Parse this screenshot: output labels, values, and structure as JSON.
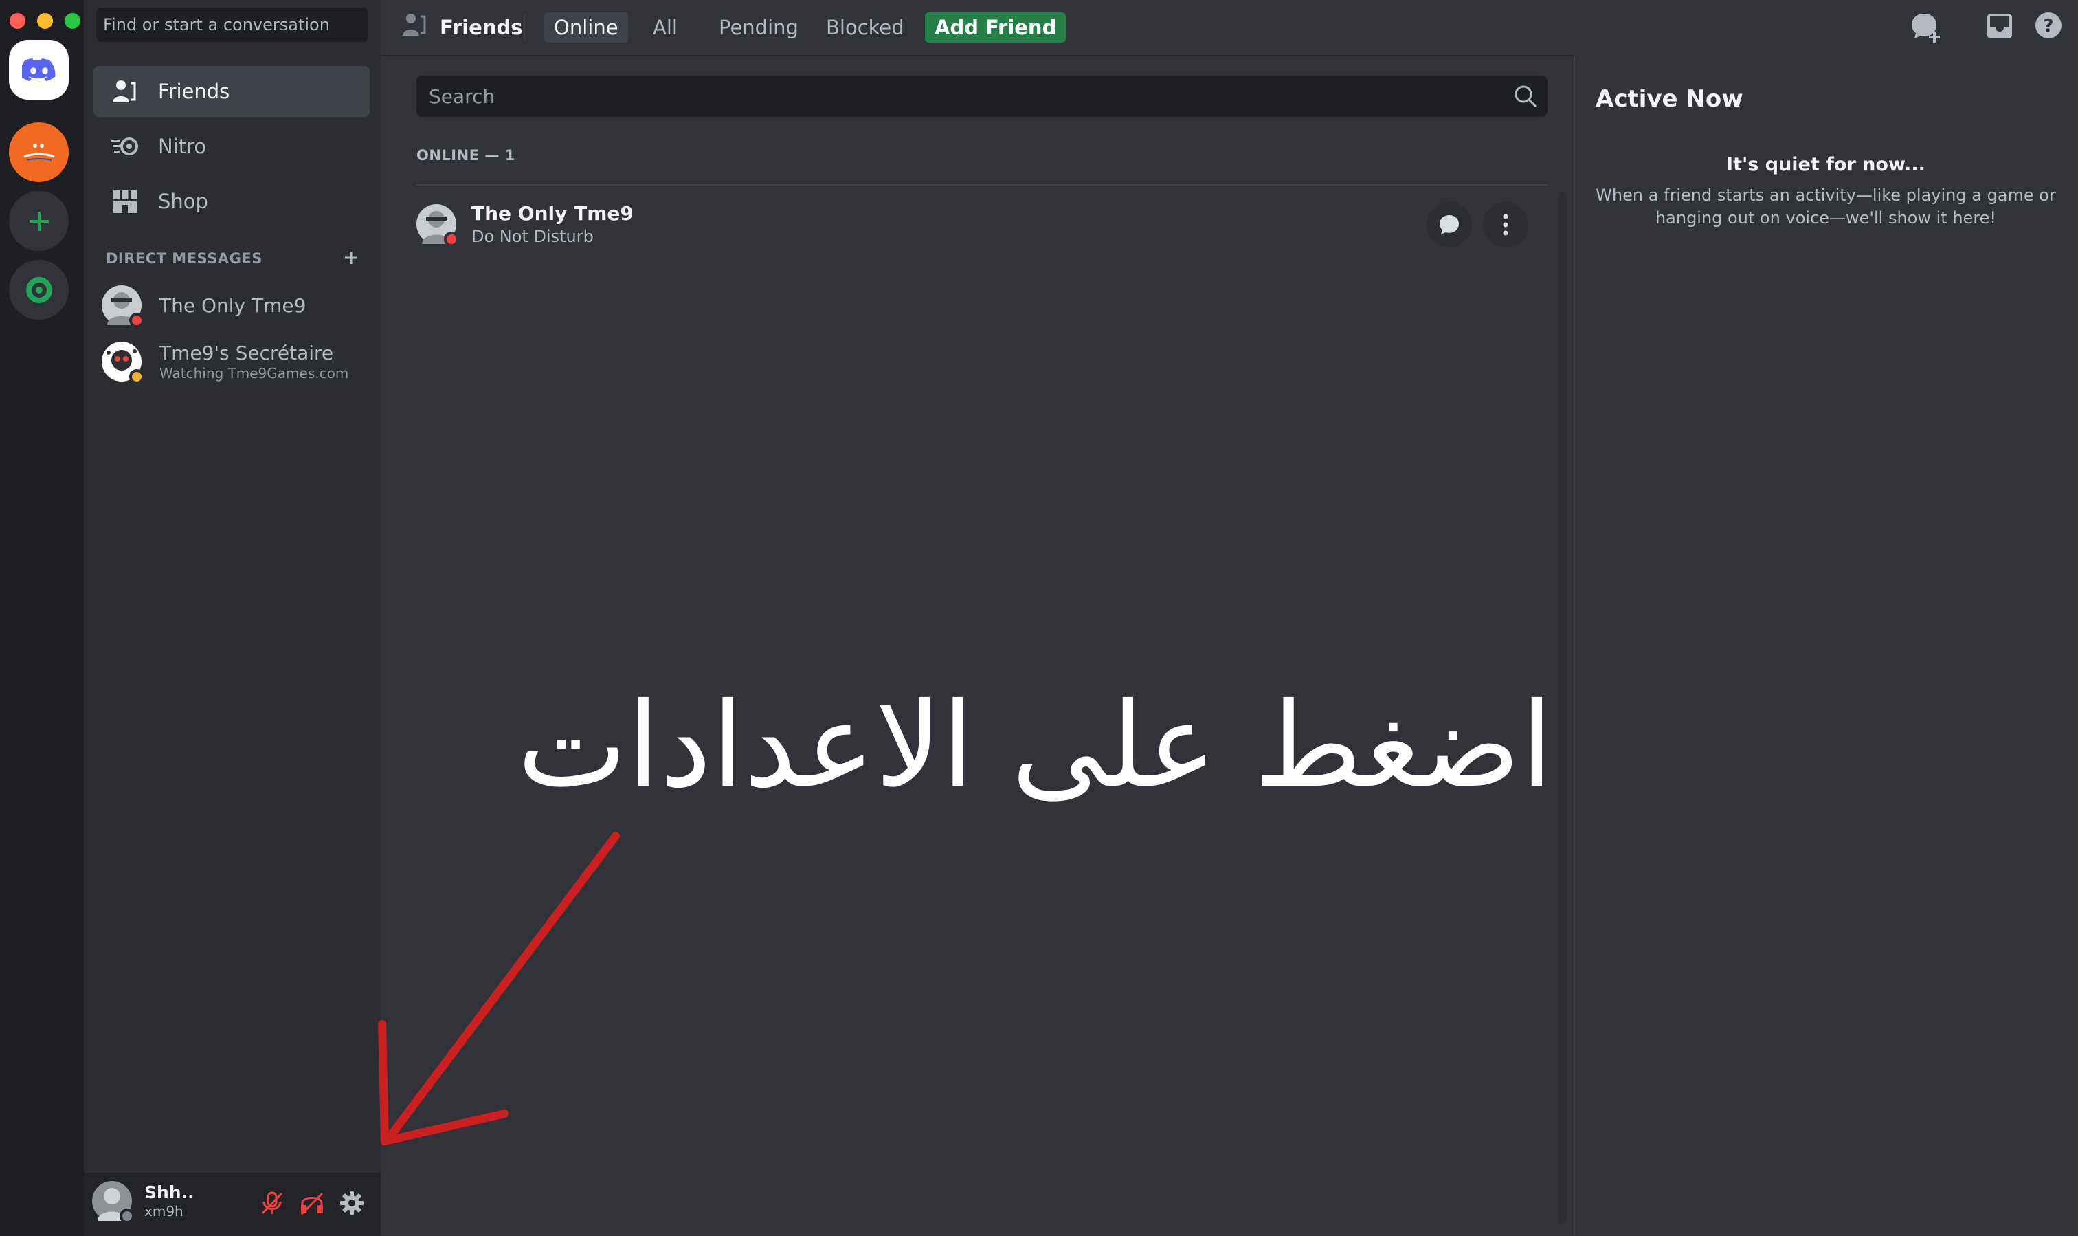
{
  "window": {
    "traffic_lights": [
      "#ff5f57",
      "#febc2e",
      "#28c840"
    ]
  },
  "rail": {
    "servers": [
      {
        "name": "home",
        "color": "#5865f2"
      },
      {
        "name": "orange-server",
        "color": "#f26a21"
      },
      {
        "name": "add-server",
        "color": "#23a559"
      },
      {
        "name": "explore",
        "color": "#23a559"
      }
    ]
  },
  "sidebar": {
    "search_placeholder": "Find or start a conversation",
    "nav": [
      {
        "label": "Friends",
        "icon": "friends-icon"
      },
      {
        "label": "Nitro",
        "icon": "nitro-icon"
      },
      {
        "label": "Shop",
        "icon": "shop-icon"
      }
    ],
    "dm_header": "DIRECT MESSAGES",
    "dms": [
      {
        "name": "The Only Tme9",
        "subtitle": "",
        "status": "dnd"
      },
      {
        "name": "Tme9's Secrétaire",
        "subtitle": "Watching Tme9Games.com",
        "status": "idle"
      }
    ]
  },
  "user_panel": {
    "display_name": "Shh..",
    "username": "xm9h"
  },
  "header": {
    "title": "Friends",
    "tabs": [
      "Online",
      "All",
      "Pending",
      "Blocked"
    ],
    "add_friend": "Add Friend",
    "colors": {
      "add_friend_bg": "#248046",
      "accent": "#5865f2",
      "dnd": "#f23f43",
      "idle": "#f0b232"
    }
  },
  "main": {
    "search_placeholder": "Search",
    "section_header": "ONLINE — 1",
    "friends": [
      {
        "name": "The Only Tme9",
        "status": "Do Not Disturb"
      }
    ],
    "annotation": "اضغط على الاعدادات"
  },
  "active_now": {
    "title": "Active Now",
    "empty_title": "It's quiet for now...",
    "empty_body_line1": "When a friend starts an activity—like playing a game or",
    "empty_body_line2": "hanging out on voice—we'll show it here!"
  }
}
